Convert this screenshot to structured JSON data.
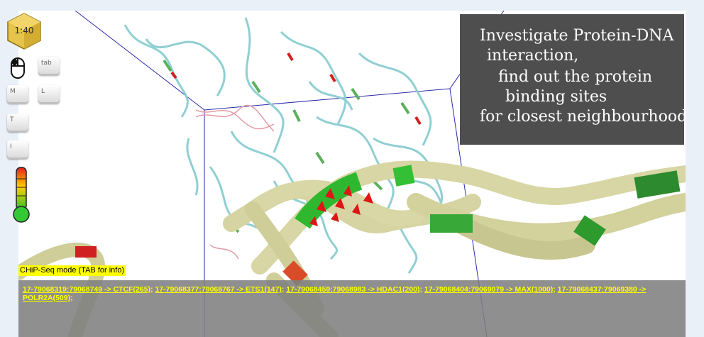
{
  "timer": {
    "value": "1:40"
  },
  "controls": {
    "tab_key": "tab",
    "m_key": "M",
    "l_key": "L",
    "t_key": "T",
    "i_key": "I"
  },
  "info": {
    "lines": [
      "Investigate Protein-DNA",
      "interaction,",
      "find out the protein",
      "binding sites",
      "for closest neighbourhood"
    ]
  },
  "mode": {
    "label": "CHiP-Seq mode (TAB for info)"
  },
  "results": {
    "hits": [
      "17-79068319:79068749 -> CTCF(265)",
      "17-79068377:79068767 -> ETS1(147)",
      "17-79068459:79068983 -> HDAC1(200)",
      "17-79068404:79069079 -> MAX(1000)",
      "17-79068437:79069380 -> POLR2A(509)"
    ]
  },
  "colors": {
    "panel_bg": "#4e4e4e",
    "highlight": "#ffff00",
    "results_bg": "#808080",
    "dna_strand": "#d8d6a4",
    "binding_site": "#2fb82f",
    "hotspot": "#e02020",
    "box_outline": "#2020a0"
  }
}
